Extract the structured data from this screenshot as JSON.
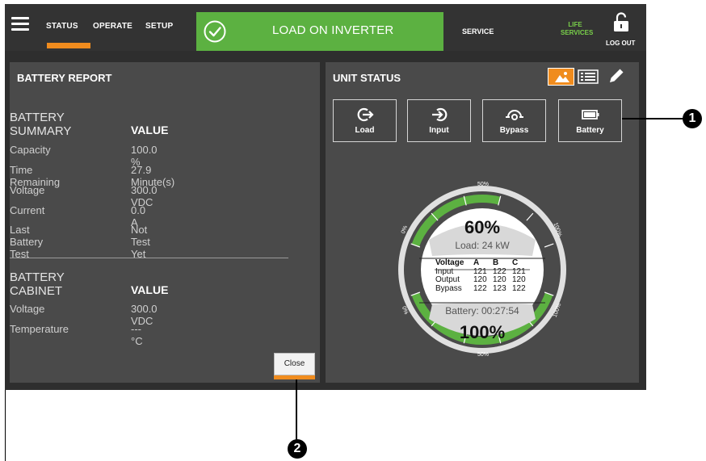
{
  "nav": {
    "tabs": [
      "STATUS",
      "OPERATE",
      "SETUP"
    ],
    "active_tab": "STATUS",
    "status_banner": "LOAD ON INVERTER",
    "service": "SERVICE",
    "life_services_line1": "LIFE",
    "life_services_line2": "SERVICES",
    "logout": "LOG OUT",
    "accent_color": "#f08c1e",
    "banner_color": "#5cb141"
  },
  "battery_report": {
    "title": "BATTERY REPORT",
    "summary": {
      "title": "BATTERY SUMMARY",
      "value_header": "VALUE",
      "rows": [
        {
          "label": "Capacity",
          "value": "100.0 %"
        },
        {
          "label": "Time Remaining",
          "value": "27.9 Minute(s)"
        },
        {
          "label": "Voltage",
          "value": "300.0 VDC"
        },
        {
          "label": "Current",
          "value": "0.0 A"
        },
        {
          "label": "Last Battery Test",
          "value": "Not Test Yet"
        }
      ]
    },
    "cabinet": {
      "title": "BATTERY CABINET",
      "value_header": "VALUE",
      "rows": [
        {
          "label": "Voltage",
          "value": "300.0 VDC"
        },
        {
          "label": "Temperature",
          "value": "--- °C"
        }
      ]
    },
    "close_label": "Close"
  },
  "unit_status": {
    "title": "UNIT STATUS",
    "buttons": [
      {
        "label": "Load",
        "icon": "load-icon"
      },
      {
        "label": "Input",
        "icon": "input-icon"
      },
      {
        "label": "Bypass",
        "icon": "bypass-icon"
      },
      {
        "label": "Battery",
        "icon": "battery-icon"
      }
    ],
    "gauge": {
      "load_percent": "60%",
      "load_value": 60,
      "load_text": "Load: 24 kW",
      "battery_percent": "100%",
      "battery_value": 100,
      "battery_text": "Battery: 00:27:54",
      "scale_labels": {
        "zero": "0%",
        "fifty": "50%",
        "hundred": "100%"
      },
      "voltage_table": {
        "header": [
          "Voltage",
          "A",
          "B",
          "C"
        ],
        "rows": [
          {
            "label": "Input",
            "a": "121",
            "b": "122",
            "c": "121"
          },
          {
            "label": "Output",
            "a": "120",
            "b": "120",
            "c": "120"
          },
          {
            "label": "Bypass",
            "a": "122",
            "b": "123",
            "c": "122"
          }
        ]
      }
    }
  },
  "callouts": [
    "1",
    "2"
  ]
}
